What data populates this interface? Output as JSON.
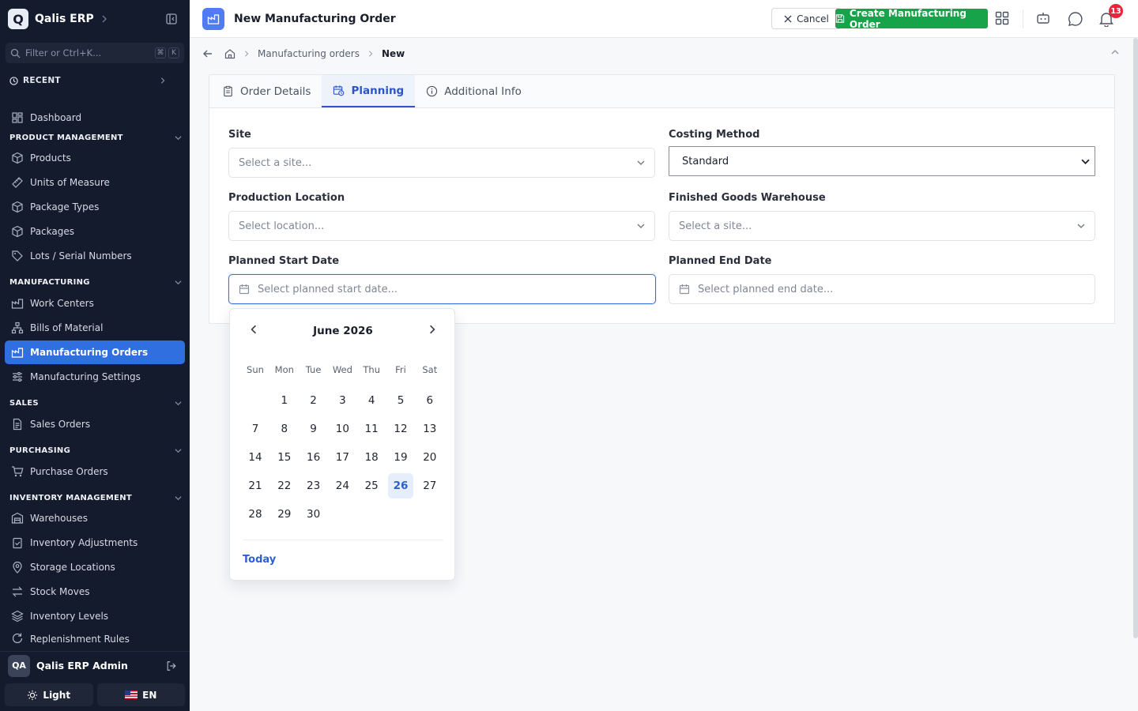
{
  "sidebar": {
    "app_name": "Qalis ERP",
    "logo_letter": "Q",
    "filter_placeholder": "Filter or Ctrl+K...",
    "kbd": [
      "⌘",
      "K"
    ],
    "recent_label": "RECENT",
    "dashboard": "Dashboard",
    "sections": {
      "product": "PRODUCT MANAGEMENT",
      "manufacturing": "MANUFACTURING",
      "sales": "SALES",
      "purchasing": "PURCHASING",
      "inventory": "INVENTORY MANAGEMENT"
    },
    "items": {
      "products": "Products",
      "uom": "Units of Measure",
      "package_types": "Package Types",
      "packages": "Packages",
      "lots": "Lots / Serial Numbers",
      "work_centers": "Work Centers",
      "bom": "Bills of Material",
      "mo": "Manufacturing Orders",
      "mfg_settings": "Manufacturing Settings",
      "sales_orders": "Sales Orders",
      "purchase_orders": "Purchase Orders",
      "warehouses": "Warehouses",
      "inv_adjust": "Inventory Adjustments",
      "storage": "Storage Locations",
      "stock_moves": "Stock Moves",
      "inv_levels": "Inventory Levels",
      "replenish": "Replenishment Rules"
    },
    "user": {
      "initials": "QA",
      "name": "Qalis ERP Admin"
    },
    "theme_label": "Light",
    "lang_label": "EN"
  },
  "topbar": {
    "title": "New Manufacturing Order",
    "cancel_label": "Cancel",
    "create_label": "Create Manufacturing Order",
    "notification_count": "13"
  },
  "breadcrumb": {
    "parent": "Manufacturing orders",
    "current": "New"
  },
  "tabs": [
    "Order Details",
    "Planning",
    "Additional Info"
  ],
  "form": {
    "site_label": "Site",
    "site_placeholder": "Select a site...",
    "costing_label": "Costing Method",
    "costing_value": "Standard",
    "prod_loc_label": "Production Location",
    "prod_loc_placeholder": "Select location...",
    "fg_wh_label": "Finished Goods Warehouse",
    "fg_wh_placeholder": "Select a site...",
    "start_label": "Planned Start Date",
    "start_placeholder": "Select planned start date...",
    "end_label": "Planned End Date",
    "end_placeholder": "Select planned end date..."
  },
  "calendar": {
    "month_label": "June 2026",
    "weekdays": [
      "Sun",
      "Mon",
      "Tue",
      "Wed",
      "Thu",
      "Fri",
      "Sat"
    ],
    "first_weekday_index": 1,
    "days_in_month": 30,
    "today": 26,
    "today_label": "Today"
  },
  "colors": {
    "sidebar_bg": "#141b2d",
    "active_item": "#2f6fe0",
    "create_button": "#16a34a",
    "accent": "#2c55c8",
    "badge": "#e5263b"
  }
}
